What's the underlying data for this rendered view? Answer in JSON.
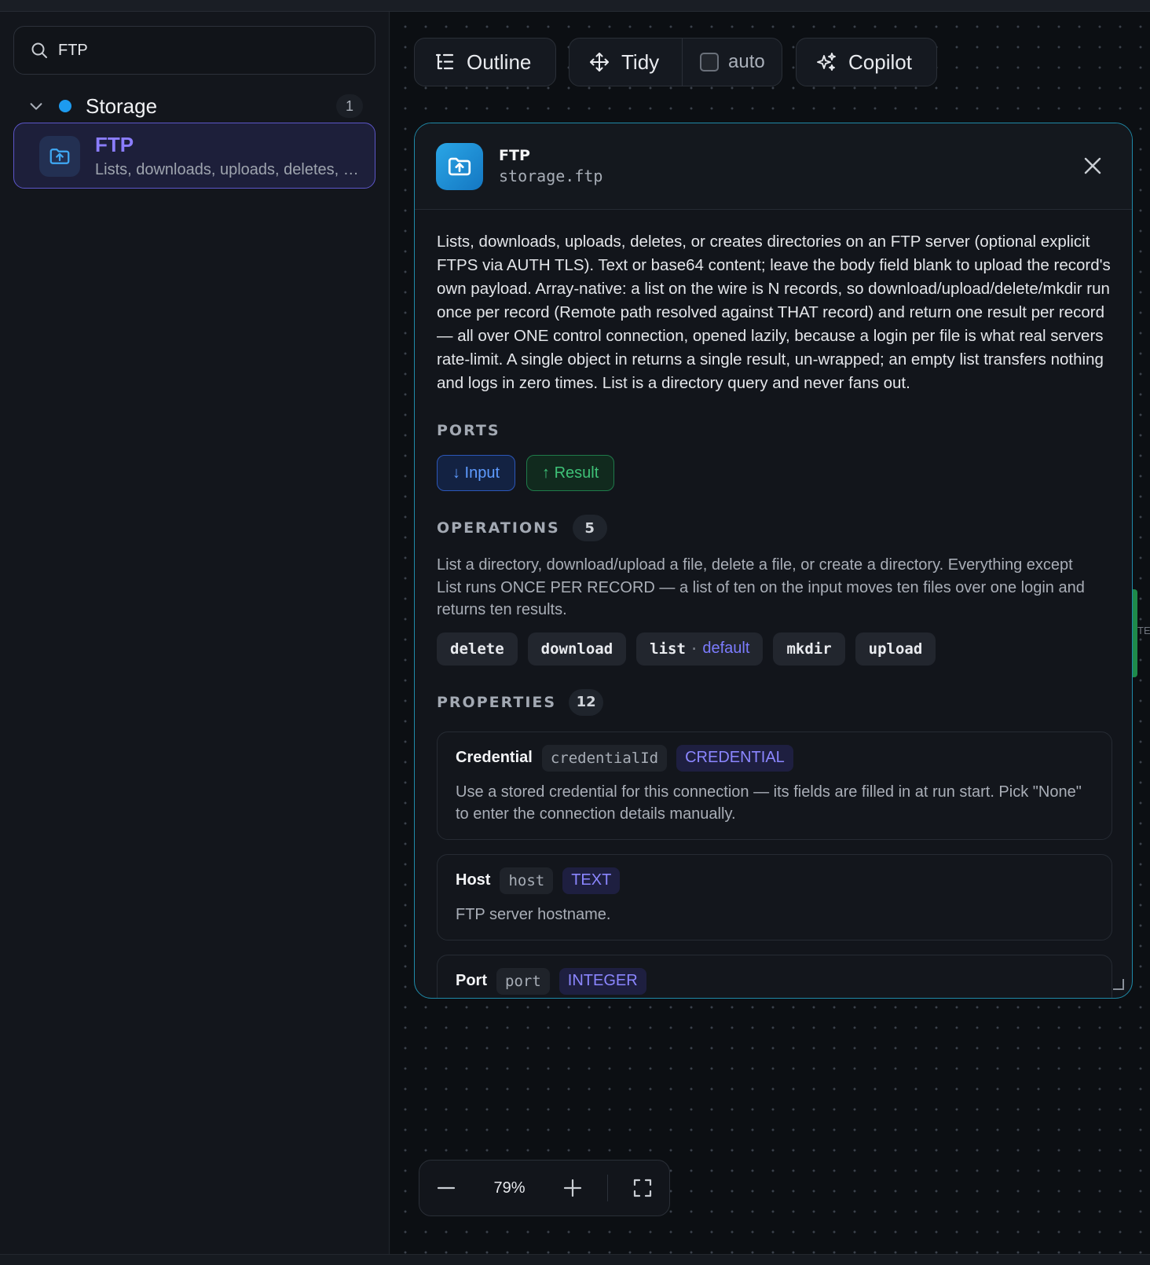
{
  "sidebar": {
    "search": {
      "value": "FTP",
      "icon": "search-icon"
    },
    "group": {
      "name": "Storage",
      "count": "1",
      "color": "#1d9bf0"
    },
    "items": [
      {
        "title": "FTP",
        "description": "Lists, downloads, uploads, deletes, o...",
        "icon": "folder-upload-icon"
      }
    ]
  },
  "toolbar": {
    "outline_label": "Outline",
    "tidy_label": "Tidy",
    "auto_label": "auto",
    "auto_checked": false,
    "copilot_label": "Copilot"
  },
  "panel": {
    "title": "FTP",
    "slug": "storage.ftp",
    "description": "Lists, downloads, uploads, deletes, or creates directories on an FTP server (optional explicit FTPS via AUTH TLS). Text or base64 content; leave the body field blank to upload the record's own payload. Array-native: a list on the wire is N records, so download/upload/delete/mkdir run once per record (Remote path resolved against THAT record) and return one result per record — all over ONE control connection, opened lazily, because a login per file is what real servers rate-limit. A single object in returns a single result, un-wrapped; an empty list transfers nothing and logs in zero times. List is a directory query and never fans out.",
    "ports_heading": "PORTS",
    "ports": {
      "input": "↓ Input",
      "result": "↑ Result"
    },
    "operations_heading": "OPERATIONS",
    "operations_count": "5",
    "operations_desc": "List a directory, download/upload a file, delete a file, or create a directory. Everything except List runs ONCE PER RECORD — a list of ten on the input moves ten files over one login and returns ten results.",
    "operations": [
      {
        "name": "delete"
      },
      {
        "name": "download"
      },
      {
        "name": "list",
        "sep": "·",
        "tag": "default"
      },
      {
        "name": "mkdir"
      },
      {
        "name": "upload"
      }
    ],
    "properties_heading": "PROPERTIES",
    "properties_count": "12",
    "properties": [
      {
        "name": "Credential",
        "key": "credentialId",
        "type": "CREDENTIAL",
        "desc": "Use a stored credential for this connection — its fields are filled in at run start. Pick \"None\" to enter the connection details manually."
      },
      {
        "name": "Host",
        "key": "host",
        "type": "TEXT",
        "desc": "FTP server hostname."
      },
      {
        "name": "Port",
        "key": "port",
        "type": "INTEGER",
        "desc": ""
      }
    ]
  },
  "zoom": {
    "value": "79%"
  },
  "colors": {
    "accent": "#8b7dff",
    "panel_border": "#1f8aa8",
    "input_port": "#5e9bff",
    "result_port": "#3ec177"
  }
}
